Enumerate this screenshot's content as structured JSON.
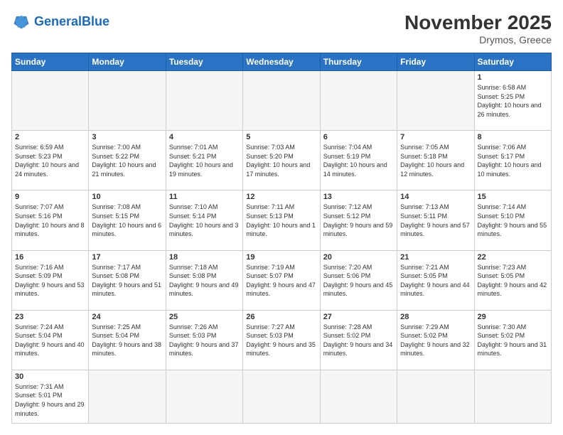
{
  "header": {
    "logo_general": "General",
    "logo_blue": "Blue",
    "month_title": "November 2025",
    "location": "Drymos, Greece"
  },
  "weekdays": [
    "Sunday",
    "Monday",
    "Tuesday",
    "Wednesday",
    "Thursday",
    "Friday",
    "Saturday"
  ],
  "days": {
    "1": {
      "sunrise": "6:58 AM",
      "sunset": "5:25 PM",
      "daylight": "10 hours and 26 minutes."
    },
    "2": {
      "sunrise": "6:59 AM",
      "sunset": "5:23 PM",
      "daylight": "10 hours and 24 minutes."
    },
    "3": {
      "sunrise": "7:00 AM",
      "sunset": "5:22 PM",
      "daylight": "10 hours and 21 minutes."
    },
    "4": {
      "sunrise": "7:01 AM",
      "sunset": "5:21 PM",
      "daylight": "10 hours and 19 minutes."
    },
    "5": {
      "sunrise": "7:03 AM",
      "sunset": "5:20 PM",
      "daylight": "10 hours and 17 minutes."
    },
    "6": {
      "sunrise": "7:04 AM",
      "sunset": "5:19 PM",
      "daylight": "10 hours and 14 minutes."
    },
    "7": {
      "sunrise": "7:05 AM",
      "sunset": "5:18 PM",
      "daylight": "10 hours and 12 minutes."
    },
    "8": {
      "sunrise": "7:06 AM",
      "sunset": "5:17 PM",
      "daylight": "10 hours and 10 minutes."
    },
    "9": {
      "sunrise": "7:07 AM",
      "sunset": "5:16 PM",
      "daylight": "10 hours and 8 minutes."
    },
    "10": {
      "sunrise": "7:08 AM",
      "sunset": "5:15 PM",
      "daylight": "10 hours and 6 minutes."
    },
    "11": {
      "sunrise": "7:10 AM",
      "sunset": "5:14 PM",
      "daylight": "10 hours and 3 minutes."
    },
    "12": {
      "sunrise": "7:11 AM",
      "sunset": "5:13 PM",
      "daylight": "10 hours and 1 minute."
    },
    "13": {
      "sunrise": "7:12 AM",
      "sunset": "5:12 PM",
      "daylight": "9 hours and 59 minutes."
    },
    "14": {
      "sunrise": "7:13 AM",
      "sunset": "5:11 PM",
      "daylight": "9 hours and 57 minutes."
    },
    "15": {
      "sunrise": "7:14 AM",
      "sunset": "5:10 PM",
      "daylight": "9 hours and 55 minutes."
    },
    "16": {
      "sunrise": "7:16 AM",
      "sunset": "5:09 PM",
      "daylight": "9 hours and 53 minutes."
    },
    "17": {
      "sunrise": "7:17 AM",
      "sunset": "5:08 PM",
      "daylight": "9 hours and 51 minutes."
    },
    "18": {
      "sunrise": "7:18 AM",
      "sunset": "5:08 PM",
      "daylight": "9 hours and 49 minutes."
    },
    "19": {
      "sunrise": "7:19 AM",
      "sunset": "5:07 PM",
      "daylight": "9 hours and 47 minutes."
    },
    "20": {
      "sunrise": "7:20 AM",
      "sunset": "5:06 PM",
      "daylight": "9 hours and 45 minutes."
    },
    "21": {
      "sunrise": "7:21 AM",
      "sunset": "5:05 PM",
      "daylight": "9 hours and 44 minutes."
    },
    "22": {
      "sunrise": "7:23 AM",
      "sunset": "5:05 PM",
      "daylight": "9 hours and 42 minutes."
    },
    "23": {
      "sunrise": "7:24 AM",
      "sunset": "5:04 PM",
      "daylight": "9 hours and 40 minutes."
    },
    "24": {
      "sunrise": "7:25 AM",
      "sunset": "5:04 PM",
      "daylight": "9 hours and 38 minutes."
    },
    "25": {
      "sunrise": "7:26 AM",
      "sunset": "5:03 PM",
      "daylight": "9 hours and 37 minutes."
    },
    "26": {
      "sunrise": "7:27 AM",
      "sunset": "5:03 PM",
      "daylight": "9 hours and 35 minutes."
    },
    "27": {
      "sunrise": "7:28 AM",
      "sunset": "5:02 PM",
      "daylight": "9 hours and 34 minutes."
    },
    "28": {
      "sunrise": "7:29 AM",
      "sunset": "5:02 PM",
      "daylight": "9 hours and 32 minutes."
    },
    "29": {
      "sunrise": "7:30 AM",
      "sunset": "5:02 PM",
      "daylight": "9 hours and 31 minutes."
    },
    "30": {
      "sunrise": "7:31 AM",
      "sunset": "5:01 PM",
      "daylight": "9 hours and 29 minutes."
    }
  }
}
